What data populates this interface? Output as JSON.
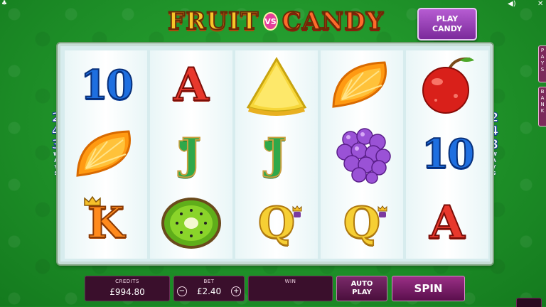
{
  "game": {
    "logo_word_1": "FRUIT",
    "logo_vs": "VS",
    "logo_word_2": "CANDY",
    "play_candy_line1": "PLAY",
    "play_candy_line2": "CANDY"
  },
  "ways": {
    "digits": [
      "2",
      "4",
      "3"
    ],
    "label_letters": [
      "W",
      "A",
      "Y",
      "S"
    ]
  },
  "side_tabs": {
    "pays": "PAYS",
    "bank": "BANK"
  },
  "reels": [
    [
      "10",
      "orange",
      "K"
    ],
    [
      "A",
      "J",
      "kiwi"
    ],
    [
      "pineapple",
      "J",
      "Q"
    ],
    [
      "orange",
      "grapes",
      "Q"
    ],
    [
      "cherry",
      "10",
      "A"
    ]
  ],
  "bottom_bar": {
    "credits_label": "CREDITS",
    "credits_value": "£994.80",
    "bet_label": "BET",
    "bet_value": "£2.40",
    "bet_minus": "−",
    "bet_plus": "+",
    "win_label": "WIN",
    "win_value": "",
    "autoplay_line1": "AUTO",
    "autoplay_line2": "PLAY",
    "spin_label": "SPIN"
  },
  "colors": {
    "background": "#21962b",
    "panel": "#3a0f2c",
    "accent": "#9a2f86"
  }
}
